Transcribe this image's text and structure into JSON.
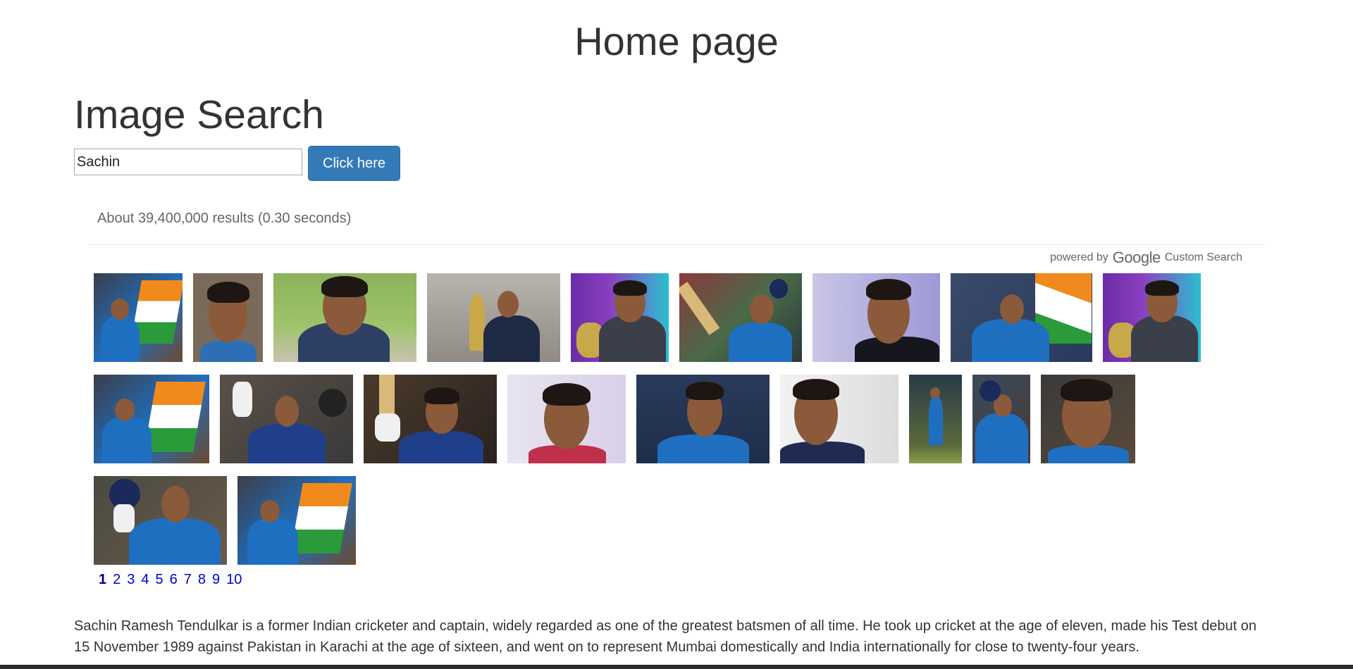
{
  "page": {
    "title": "Home page"
  },
  "search": {
    "heading": "Image Search",
    "input_value": "Sachin",
    "button_label": "Click here"
  },
  "results": {
    "summary": "About 39,400,000 results (0.30 seconds)",
    "branding_prefix": "powered by",
    "branding_logo": "Google",
    "branding_suffix": "Custom Search"
  },
  "pagination": [
    "1",
    "2",
    "3",
    "4",
    "5",
    "6",
    "7",
    "8",
    "9",
    "10"
  ],
  "pagination_current": "1",
  "bio": "Sachin Ramesh Tendulkar is a former Indian cricketer and captain, widely regarded as one of the greatest batsmen of all time. He took up cricket at the age of eleven, made his Test debut on 15 November 1989 against Pakistan in Karachi at the age of sixteen, and went on to represent Mumbai domestically and India internationally for close to twenty-four years.",
  "colors": {
    "button_bg": "#337ab7",
    "link": "#0000cc",
    "india_blue": "#1f6fc1"
  }
}
